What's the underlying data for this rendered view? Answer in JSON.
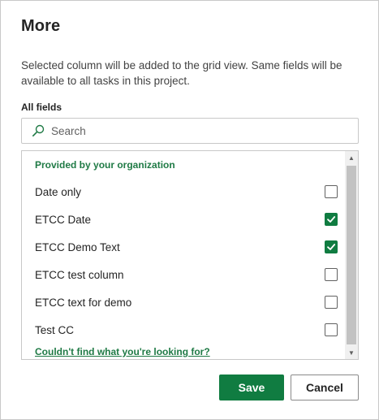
{
  "dialog": {
    "title": "More",
    "description": "Selected column will be added to the grid view. Same fields will be available to all tasks in this project.",
    "all_fields_label": "All fields",
    "search": {
      "placeholder": "Search",
      "value": ""
    },
    "section_header": "Provided by your organization",
    "fields": [
      {
        "label": "Date only",
        "checked": false
      },
      {
        "label": "ETCC Date",
        "checked": true
      },
      {
        "label": "ETCC Demo Text",
        "checked": true
      },
      {
        "label": "ETCC test column",
        "checked": false
      },
      {
        "label": "ETCC text for demo",
        "checked": false
      },
      {
        "label": "Test CC",
        "checked": false
      }
    ],
    "help_link": "Couldn't find what you're looking for?",
    "save_label": "Save",
    "cancel_label": "Cancel"
  },
  "colors": {
    "accent": "#107c41",
    "link": "#1f7a45"
  },
  "icons": {
    "search": "search-icon",
    "checkmark": "checkmark-icon"
  }
}
